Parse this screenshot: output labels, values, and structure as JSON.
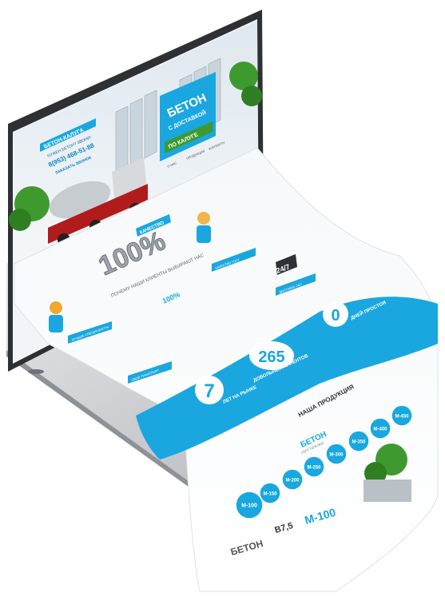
{
  "site": {
    "logo": "БЕТОН-КАЛУГА",
    "need_concrete": "НУЖЕН БЕТОН? ЗВОНИ!",
    "phone": "8(953) 468-51-88",
    "callback": "ЗАКАЗАТЬ ЗВОНОК",
    "nav": [
      "О НАС",
      "ПРОДУКЦИЯ",
      "КОНТАКТЫ"
    ],
    "hero_line1": "БЕТОН",
    "hero_line2": "С ДОСТАВКОЙ",
    "hero_line3": "ПО КАЛУГЕ"
  },
  "why": {
    "quality_badge": "КАЧЕСТВО",
    "big_percent": "100%",
    "heading": "ПОЧЕМУ НАШИ КЛИЕНТЫ ВЫБИРАЮТ НАС",
    "percent_small": "100%",
    "badge_247": "24/7",
    "features": [
      "ЛУЧШИЕ СПЕЦИАЛИСТЫ",
      "СВОЙ ТРАНСПОРТ",
      "ДОСТАВКА 24/7",
      "КАЧЕСТВО ГОСТ"
    ]
  },
  "stats": [
    {
      "value": "7",
      "label": "ЛЕТ НА РЫНКЕ"
    },
    {
      "value": "265",
      "label": "ДОВОЛЬНЫХ КЛИЕНТОВ"
    },
    {
      "value": "0",
      "label": "ДНЕЙ ПРОСТОЯ"
    }
  ],
  "products": {
    "heading": "НАША ПРОДУКЦИЯ",
    "beton_label": "БЕТОН",
    "gost": "ГОСТ 7473-2010",
    "grades": [
      "М-100",
      "М-150",
      "М-200",
      "М-250",
      "М-300",
      "М-350",
      "М-400",
      "М-450"
    ],
    "bottom_title": "БЕТОН",
    "bottom_class": "B7,5",
    "bottom_grade": "М-100"
  },
  "colors": {
    "accent": "#1aa7df",
    "accent_dark": "#0f86bd",
    "green": "#3e9a2e",
    "laptop": "#3a3c40"
  }
}
